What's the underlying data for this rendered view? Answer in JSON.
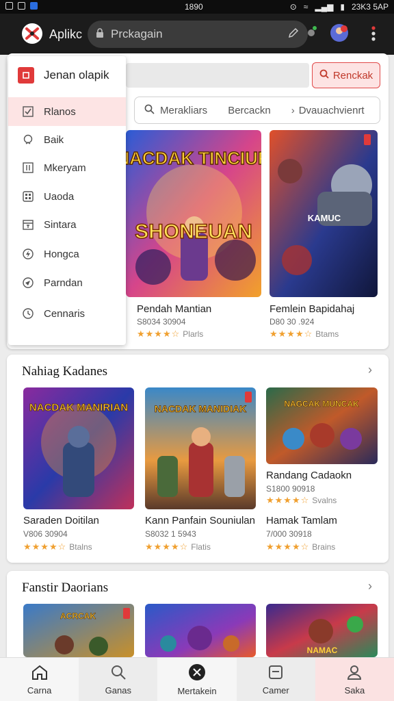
{
  "status": {
    "time": "1890",
    "right": "23K3 5AP"
  },
  "appbar": {
    "title": "Aplikc",
    "url": "Prckagain"
  },
  "search": {
    "button_label": "Renckak"
  },
  "filter": {
    "items": [
      "Merakliars",
      "Bercackn",
      "Dvauachvienrt"
    ]
  },
  "menu": {
    "title": "Jenan olapik",
    "items": [
      {
        "label": "Rlanos",
        "icon": "checkbox-icon"
      },
      {
        "label": "Baik",
        "icon": "location-icon"
      },
      {
        "label": "Mkeryam",
        "icon": "columns-icon"
      },
      {
        "label": "Uaoda",
        "icon": "grid-icon"
      },
      {
        "label": "Sintara",
        "icon": "calendar-icon"
      },
      {
        "label": "Hongca",
        "icon": "bolt-icon"
      },
      {
        "label": "Parndan",
        "icon": "compass-icon"
      },
      {
        "label": "Cennaris",
        "icon": "clock-icon"
      }
    ]
  },
  "top_games": [
    {
      "art_title": "NACDAK TINCIUR",
      "art_sub": "SHONEUAN",
      "title": "Pendah Mantian",
      "sub": "S8034 30904",
      "rating": "Plarls"
    },
    {
      "art_title": "",
      "art_sub": "KAMUC",
      "title": "Femlein Bapidahaj",
      "sub": "D80 30 .924",
      "rating": "Btams"
    }
  ],
  "sections": [
    {
      "title": "Nahiag Kadanes",
      "games": [
        {
          "art_title": "NACDAK MANIRIAN",
          "title": "Saraden Doitilan",
          "sub": "V806 30904",
          "rating": "Btalns"
        },
        {
          "art_title": "NACDAK MANIDIAK",
          "title": "Kann Panfain Souniulan",
          "sub": "S8032 1 5943",
          "rating": "Flatis"
        },
        {
          "art_title": "NAGCAK MUNCAK",
          "title": "Randang Cadaokn",
          "sub": "S1800 90918",
          "rating": "Svalns"
        },
        {
          "art_title": "",
          "title": "Hamak Tamlam",
          "sub": "7/000 30918",
          "rating": "Brains"
        }
      ]
    },
    {
      "title": "Fanstir Daorians",
      "games": [
        {
          "art_title": "ACRCAK"
        },
        {
          "art_title": ""
        },
        {
          "art_title": "NAMAC"
        }
      ]
    }
  ],
  "bottom_nav": [
    {
      "label": "Carna",
      "icon": "home-icon"
    },
    {
      "label": "Ganas",
      "icon": "search-icon"
    },
    {
      "label": "Mertakein",
      "icon": "sword-icon"
    },
    {
      "label": "Camer",
      "icon": "store-icon"
    },
    {
      "label": "Saka",
      "icon": "profile-icon"
    }
  ],
  "colors": {
    "accent": "#e04848",
    "star": "#f0a030",
    "appbar": "#1c1c1c"
  }
}
